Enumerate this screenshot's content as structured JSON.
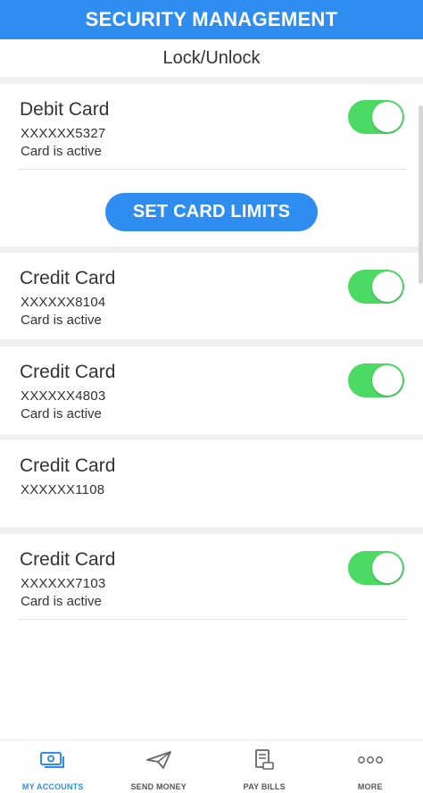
{
  "header": {
    "title": "SECURITY MANAGEMENT",
    "subtitle": "Lock/Unlock"
  },
  "colors": {
    "brand": "#2f8df0",
    "toggle_on": "#4cd964"
  },
  "cards": [
    {
      "title": "Debit Card",
      "number": "XXXXXX5327",
      "status": "Card is active",
      "toggle": "on"
    },
    {
      "title": "Credit Card",
      "number": "XXXXXX8104",
      "status": "Card is active",
      "toggle": "on"
    },
    {
      "title": "Credit Card",
      "number": "XXXXXX4803",
      "status": "Card is active",
      "toggle": "on"
    },
    {
      "title": "Credit Card",
      "number": "XXXXXX1108",
      "status": "",
      "toggle": "none"
    },
    {
      "title": "Credit Card",
      "number": "XXXXXX7103",
      "status": "Card is active",
      "toggle": "on"
    }
  ],
  "limits_button": {
    "label": "SET CARD LIMITS"
  },
  "tabbar": {
    "items": [
      {
        "label": "MY ACCOUNTS",
        "icon": "money-icon",
        "active": true
      },
      {
        "label": "SEND MONEY",
        "icon": "paper-plane-icon",
        "active": false
      },
      {
        "label": "PAY BILLS",
        "icon": "bill-icon",
        "active": false
      },
      {
        "label": "MORE",
        "icon": "more-dots-icon",
        "active": false
      }
    ]
  }
}
